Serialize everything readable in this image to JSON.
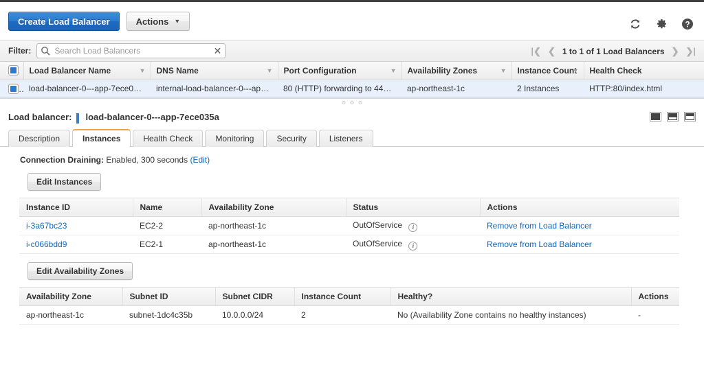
{
  "toolbar": {
    "create_button": "Create Load Balancer",
    "actions_button": "Actions",
    "actions_caret": "▼",
    "refresh_icon": "refresh-icon",
    "settings_icon": "gear-icon",
    "help_icon": "help-icon"
  },
  "filter": {
    "label": "Filter:",
    "search_value": "",
    "search_placeholder": "Search Load Balancers",
    "clear_glyph": "✕",
    "pagination": {
      "first": "|❮",
      "prev": "❮",
      "text": "1 to 1 of 1 Load Balancers",
      "next": "❯",
      "last": "❯|"
    }
  },
  "lb_table": {
    "columns": [
      "Load Balancer Name",
      "DNS Name",
      "Port Configuration",
      "Availability Zones",
      "Instance Count",
      "Health Check"
    ],
    "rows": [
      {
        "selected": true,
        "name": "load-balancer-0---app-7ece0…",
        "dns": "internal-load-balancer-0---ap…",
        "port": "80 (HTTP) forwarding to 443…",
        "zones": "ap-northeast-1c",
        "count": "2 Instances",
        "health": "HTTP:80/index.html"
      }
    ]
  },
  "detail": {
    "label": "Load balancer:",
    "name": "load-balancer-0---app-7ece035a",
    "panel_icons": [
      "panel-layout-bottom-icon",
      "panel-layout-split-icon",
      "panel-layout-top-icon"
    ],
    "tabs": [
      {
        "label": "Description",
        "active": false
      },
      {
        "label": "Instances",
        "active": true
      },
      {
        "label": "Health Check",
        "active": false
      },
      {
        "label": "Monitoring",
        "active": false
      },
      {
        "label": "Security",
        "active": false
      },
      {
        "label": "Listeners",
        "active": false
      }
    ]
  },
  "instances_panel": {
    "connection_draining_label": "Connection Draining:",
    "connection_draining_value": "Enabled, 300 seconds",
    "connection_draining_edit": "(Edit)",
    "edit_instances_button": "Edit Instances",
    "columns": [
      "Instance ID",
      "Name",
      "Availability Zone",
      "Status",
      "Actions"
    ],
    "rows": [
      {
        "instance_id": "i-3a67bc23",
        "name": "EC2-2",
        "zone": "ap-northeast-1c",
        "status": "OutOfService",
        "status_info_icon": "info-icon",
        "action": "Remove from Load Balancer"
      },
      {
        "instance_id": "i-c066bdd9",
        "name": "EC2-1",
        "zone": "ap-northeast-1c",
        "status": "OutOfService",
        "status_info_icon": "info-icon",
        "action": "Remove from Load Balancer"
      }
    ]
  },
  "zones_panel": {
    "edit_zones_button": "Edit Availability Zones",
    "columns": [
      "Availability Zone",
      "Subnet ID",
      "Subnet CIDR",
      "Instance Count",
      "Healthy?",
      "Actions"
    ],
    "rows": [
      {
        "zone": "ap-northeast-1c",
        "subnet_id": "subnet-1dc4c35b",
        "subnet_cidr": "10.0.0.0/24",
        "instance_count": "2",
        "healthy": "No (Availability Zone contains no healthy instances)",
        "action": "-"
      }
    ]
  },
  "colors": {
    "primary_blue": "#2a7ad0",
    "link_blue": "#1166bb",
    "tab_accent": "#f2a33c",
    "selected_row": "#e8f1fb"
  }
}
